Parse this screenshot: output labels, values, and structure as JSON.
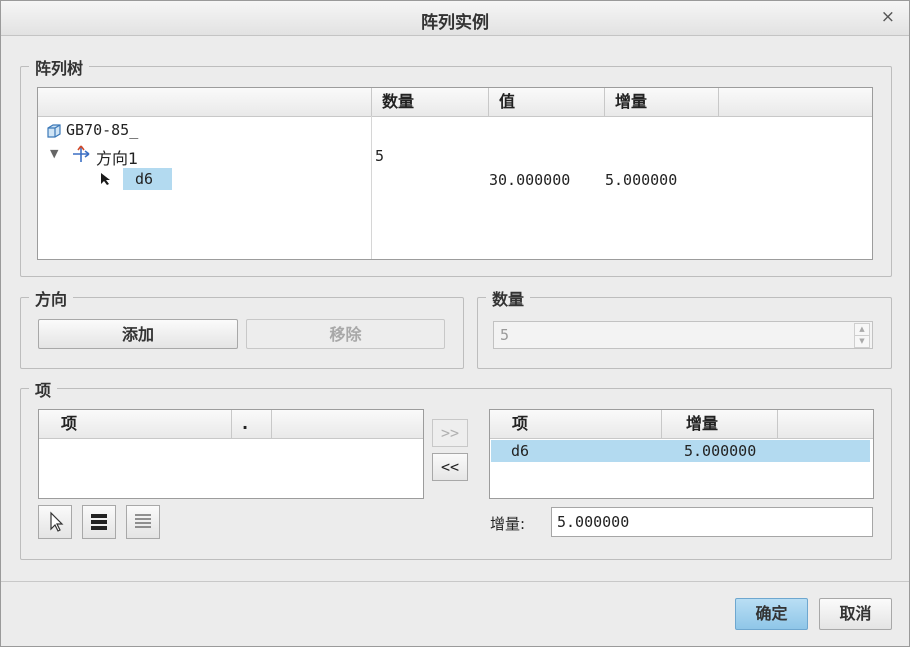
{
  "dialog": {
    "title": "阵列实例",
    "close_glyph": "×"
  },
  "pattern_tree": {
    "legend": "阵列树",
    "columns": [
      "数量",
      "值",
      "增量"
    ],
    "root": {
      "label": "GB70-85_",
      "icon": "part-icon"
    },
    "direction": {
      "label": "方向1",
      "count": "5",
      "icon": "direction-icon"
    },
    "dimension": {
      "label": "d6",
      "value": "30.000000",
      "increment": "5.000000",
      "icon": "arrow-cursor-icon"
    }
  },
  "direction_group": {
    "legend": "方向",
    "add_label": "添加",
    "remove_label": "移除"
  },
  "count_group": {
    "legend": "数量",
    "value": "5"
  },
  "items_group": {
    "legend": "项",
    "available": {
      "columns": [
        "项",
        "."
      ]
    },
    "add_arrow": ">>",
    "remove_arrow": "<<",
    "selected": {
      "columns": [
        "项",
        "增量"
      ],
      "rows": [
        {
          "item": "d6",
          "increment": "5.000000"
        }
      ]
    },
    "increment_label": "增量:",
    "increment_value": "5.000000"
  },
  "footer": {
    "ok_label": "确定",
    "cancel_label": "取消"
  },
  "colors": {
    "selection": "#b3daf0",
    "ok_button": "#9fcfec",
    "dialog_bg": "#ececec"
  }
}
